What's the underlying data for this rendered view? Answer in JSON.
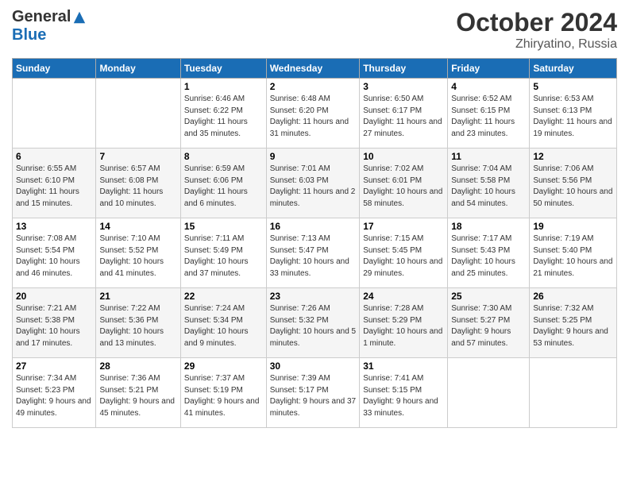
{
  "logo": {
    "general": "General",
    "blue": "Blue"
  },
  "title": "October 2024",
  "location": "Zhiryatino, Russia",
  "days_of_week": [
    "Sunday",
    "Monday",
    "Tuesday",
    "Wednesday",
    "Thursday",
    "Friday",
    "Saturday"
  ],
  "weeks": [
    [
      {
        "day": "",
        "info": ""
      },
      {
        "day": "",
        "info": ""
      },
      {
        "day": "1",
        "info": "Sunrise: 6:46 AM\nSunset: 6:22 PM\nDaylight: 11 hours and 35 minutes."
      },
      {
        "day": "2",
        "info": "Sunrise: 6:48 AM\nSunset: 6:20 PM\nDaylight: 11 hours and 31 minutes."
      },
      {
        "day": "3",
        "info": "Sunrise: 6:50 AM\nSunset: 6:17 PM\nDaylight: 11 hours and 27 minutes."
      },
      {
        "day": "4",
        "info": "Sunrise: 6:52 AM\nSunset: 6:15 PM\nDaylight: 11 hours and 23 minutes."
      },
      {
        "day": "5",
        "info": "Sunrise: 6:53 AM\nSunset: 6:13 PM\nDaylight: 11 hours and 19 minutes."
      }
    ],
    [
      {
        "day": "6",
        "info": "Sunrise: 6:55 AM\nSunset: 6:10 PM\nDaylight: 11 hours and 15 minutes."
      },
      {
        "day": "7",
        "info": "Sunrise: 6:57 AM\nSunset: 6:08 PM\nDaylight: 11 hours and 10 minutes."
      },
      {
        "day": "8",
        "info": "Sunrise: 6:59 AM\nSunset: 6:06 PM\nDaylight: 11 hours and 6 minutes."
      },
      {
        "day": "9",
        "info": "Sunrise: 7:01 AM\nSunset: 6:03 PM\nDaylight: 11 hours and 2 minutes."
      },
      {
        "day": "10",
        "info": "Sunrise: 7:02 AM\nSunset: 6:01 PM\nDaylight: 10 hours and 58 minutes."
      },
      {
        "day": "11",
        "info": "Sunrise: 7:04 AM\nSunset: 5:58 PM\nDaylight: 10 hours and 54 minutes."
      },
      {
        "day": "12",
        "info": "Sunrise: 7:06 AM\nSunset: 5:56 PM\nDaylight: 10 hours and 50 minutes."
      }
    ],
    [
      {
        "day": "13",
        "info": "Sunrise: 7:08 AM\nSunset: 5:54 PM\nDaylight: 10 hours and 46 minutes."
      },
      {
        "day": "14",
        "info": "Sunrise: 7:10 AM\nSunset: 5:52 PM\nDaylight: 10 hours and 41 minutes."
      },
      {
        "day": "15",
        "info": "Sunrise: 7:11 AM\nSunset: 5:49 PM\nDaylight: 10 hours and 37 minutes."
      },
      {
        "day": "16",
        "info": "Sunrise: 7:13 AM\nSunset: 5:47 PM\nDaylight: 10 hours and 33 minutes."
      },
      {
        "day": "17",
        "info": "Sunrise: 7:15 AM\nSunset: 5:45 PM\nDaylight: 10 hours and 29 minutes."
      },
      {
        "day": "18",
        "info": "Sunrise: 7:17 AM\nSunset: 5:43 PM\nDaylight: 10 hours and 25 minutes."
      },
      {
        "day": "19",
        "info": "Sunrise: 7:19 AM\nSunset: 5:40 PM\nDaylight: 10 hours and 21 minutes."
      }
    ],
    [
      {
        "day": "20",
        "info": "Sunrise: 7:21 AM\nSunset: 5:38 PM\nDaylight: 10 hours and 17 minutes."
      },
      {
        "day": "21",
        "info": "Sunrise: 7:22 AM\nSunset: 5:36 PM\nDaylight: 10 hours and 13 minutes."
      },
      {
        "day": "22",
        "info": "Sunrise: 7:24 AM\nSunset: 5:34 PM\nDaylight: 10 hours and 9 minutes."
      },
      {
        "day": "23",
        "info": "Sunrise: 7:26 AM\nSunset: 5:32 PM\nDaylight: 10 hours and 5 minutes."
      },
      {
        "day": "24",
        "info": "Sunrise: 7:28 AM\nSunset: 5:29 PM\nDaylight: 10 hours and 1 minute."
      },
      {
        "day": "25",
        "info": "Sunrise: 7:30 AM\nSunset: 5:27 PM\nDaylight: 9 hours and 57 minutes."
      },
      {
        "day": "26",
        "info": "Sunrise: 7:32 AM\nSunset: 5:25 PM\nDaylight: 9 hours and 53 minutes."
      }
    ],
    [
      {
        "day": "27",
        "info": "Sunrise: 7:34 AM\nSunset: 5:23 PM\nDaylight: 9 hours and 49 minutes."
      },
      {
        "day": "28",
        "info": "Sunrise: 7:36 AM\nSunset: 5:21 PM\nDaylight: 9 hours and 45 minutes."
      },
      {
        "day": "29",
        "info": "Sunrise: 7:37 AM\nSunset: 5:19 PM\nDaylight: 9 hours and 41 minutes."
      },
      {
        "day": "30",
        "info": "Sunrise: 7:39 AM\nSunset: 5:17 PM\nDaylight: 9 hours and 37 minutes."
      },
      {
        "day": "31",
        "info": "Sunrise: 7:41 AM\nSunset: 5:15 PM\nDaylight: 9 hours and 33 minutes."
      },
      {
        "day": "",
        "info": ""
      },
      {
        "day": "",
        "info": ""
      }
    ]
  ]
}
